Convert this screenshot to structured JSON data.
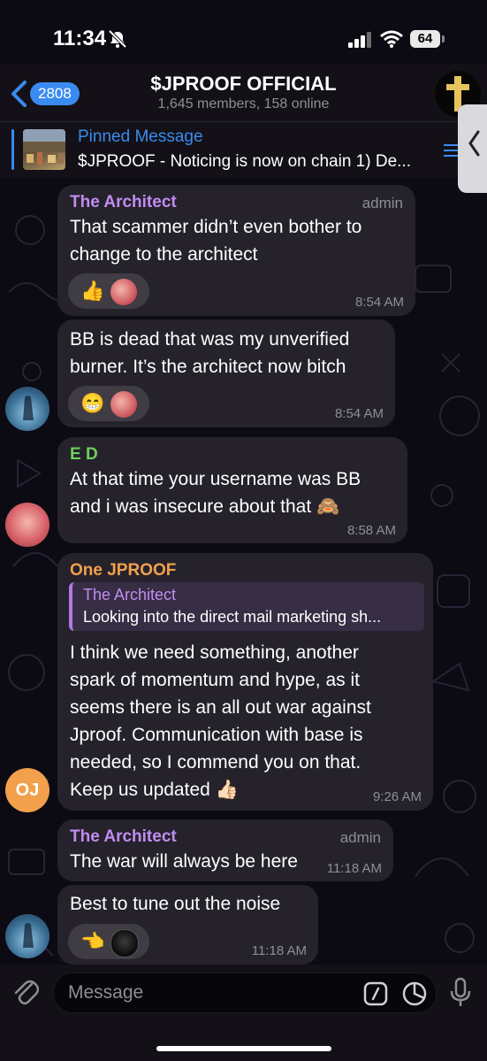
{
  "status_bar": {
    "time": "11:34",
    "battery": "64"
  },
  "header": {
    "back_count": "2808",
    "title": "$JPROOF OFFICIAL",
    "subtitle": "1,645 members, 158 online"
  },
  "pinned": {
    "title": "Pinned Message",
    "text": "$JPROOF - Noticing is now on chain 1) De..."
  },
  "messages": [
    {
      "sender": "The Architect",
      "role": "admin",
      "lines": [
        "That scammer didn’t even bother to",
        "change to the architect"
      ],
      "reactions": [
        "👍"
      ],
      "time": "8:54 AM"
    },
    {
      "lines": [
        "BB is dead that was my unverified",
        "burner. It’s the architect now bitch"
      ],
      "reactions": [
        "😁"
      ],
      "time": "8:54 AM"
    },
    {
      "sender": "E D",
      "lines": [
        "At that time your username was BB",
        "and i was insecure about that 🙈"
      ],
      "time": "8:58 AM"
    },
    {
      "sender": "One JPROOF",
      "quote": {
        "title": "The Architect",
        "text": "Looking into the direct mail marketing sh..."
      },
      "lines": [
        "I think we need something, another",
        "spark of momentum and hype, as it",
        "seems there is an all out war against",
        "Jproof.  Communication with base is",
        "needed, so I commend you on that.",
        "Keep us updated 👍🏻"
      ],
      "time": "9:26 AM",
      "avatar_initials": "OJ"
    },
    {
      "sender": "The Architect",
      "role": "admin",
      "lines": [
        "The war will always be here"
      ],
      "time": "11:18 AM"
    },
    {
      "lines": [
        "Best to tune out the noise"
      ],
      "reactions": [
        "👈"
      ],
      "time": "11:18 AM"
    }
  ],
  "input": {
    "placeholder": "Message"
  },
  "colors": {
    "accent": "#3a8bf0",
    "architect_name": "#c18cf0",
    "ed_name": "#6fcf5f",
    "one_jproof_name": "#f2a04b",
    "bubble": "#26232d",
    "timestamp": "#8e8e93"
  },
  "icons": [
    "bell-muted-icon",
    "signal-icon",
    "wifi-icon",
    "chevron-left-icon",
    "cross-icon",
    "list-icon",
    "paperclip-icon",
    "command-icon",
    "sticker-icon",
    "microphone-icon"
  ]
}
